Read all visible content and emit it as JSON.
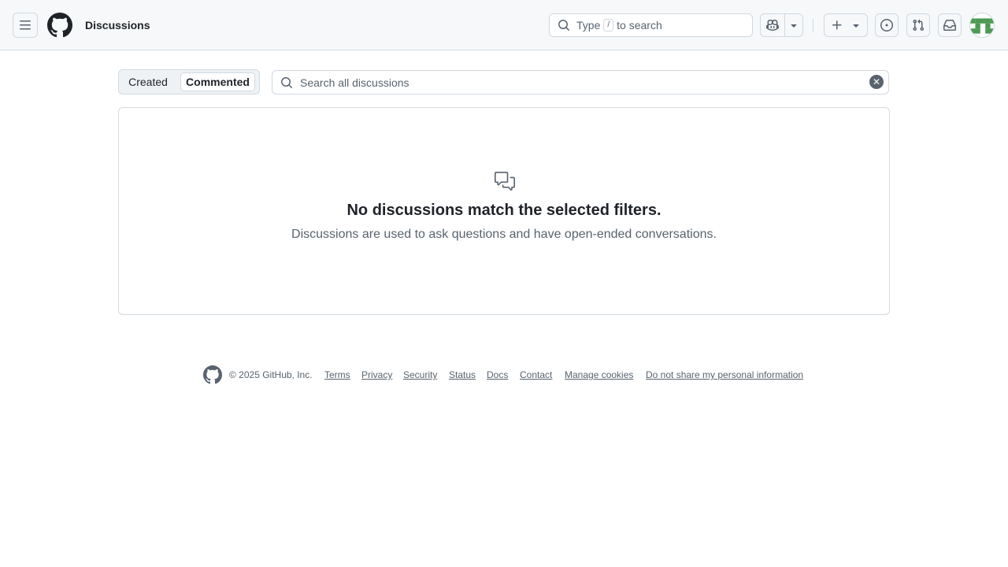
{
  "header": {
    "context_label": "Discussions",
    "search": {
      "before_kbd": "Type",
      "kbd": "/",
      "after_kbd": "to search"
    },
    "icons": {
      "menu": "hamburger-icon",
      "logo": "github-mark-icon",
      "copilot": "copilot-icon",
      "copilot_dropdown": "triangle-down-icon",
      "create": "plus-icon",
      "create_dropdown": "triangle-down-icon",
      "issues": "issue-opened-icon",
      "pull_requests": "git-pull-request-icon",
      "inbox": "inbox-icon",
      "avatar": "user-avatar"
    }
  },
  "filters": {
    "tabs": [
      {
        "label": "Created",
        "selected": false
      },
      {
        "label": "Commented",
        "selected": true
      }
    ],
    "search_placeholder": "Search all discussions"
  },
  "blankslate": {
    "icon": "comment-discussion-icon",
    "title": "No discussions match the selected filters.",
    "description": "Discussions are used to ask questions and have open-ended conversations."
  },
  "footer": {
    "copyright": "© 2025 GitHub, Inc.",
    "links": [
      "Terms",
      "Privacy",
      "Security",
      "Status",
      "Docs",
      "Contact",
      "Manage cookies",
      "Do not share my personal information"
    ]
  },
  "colors": {
    "header_bg": "#f6f8fa",
    "border": "#d1d9e0",
    "text_primary": "#1f2328",
    "text_muted": "#59636e"
  }
}
